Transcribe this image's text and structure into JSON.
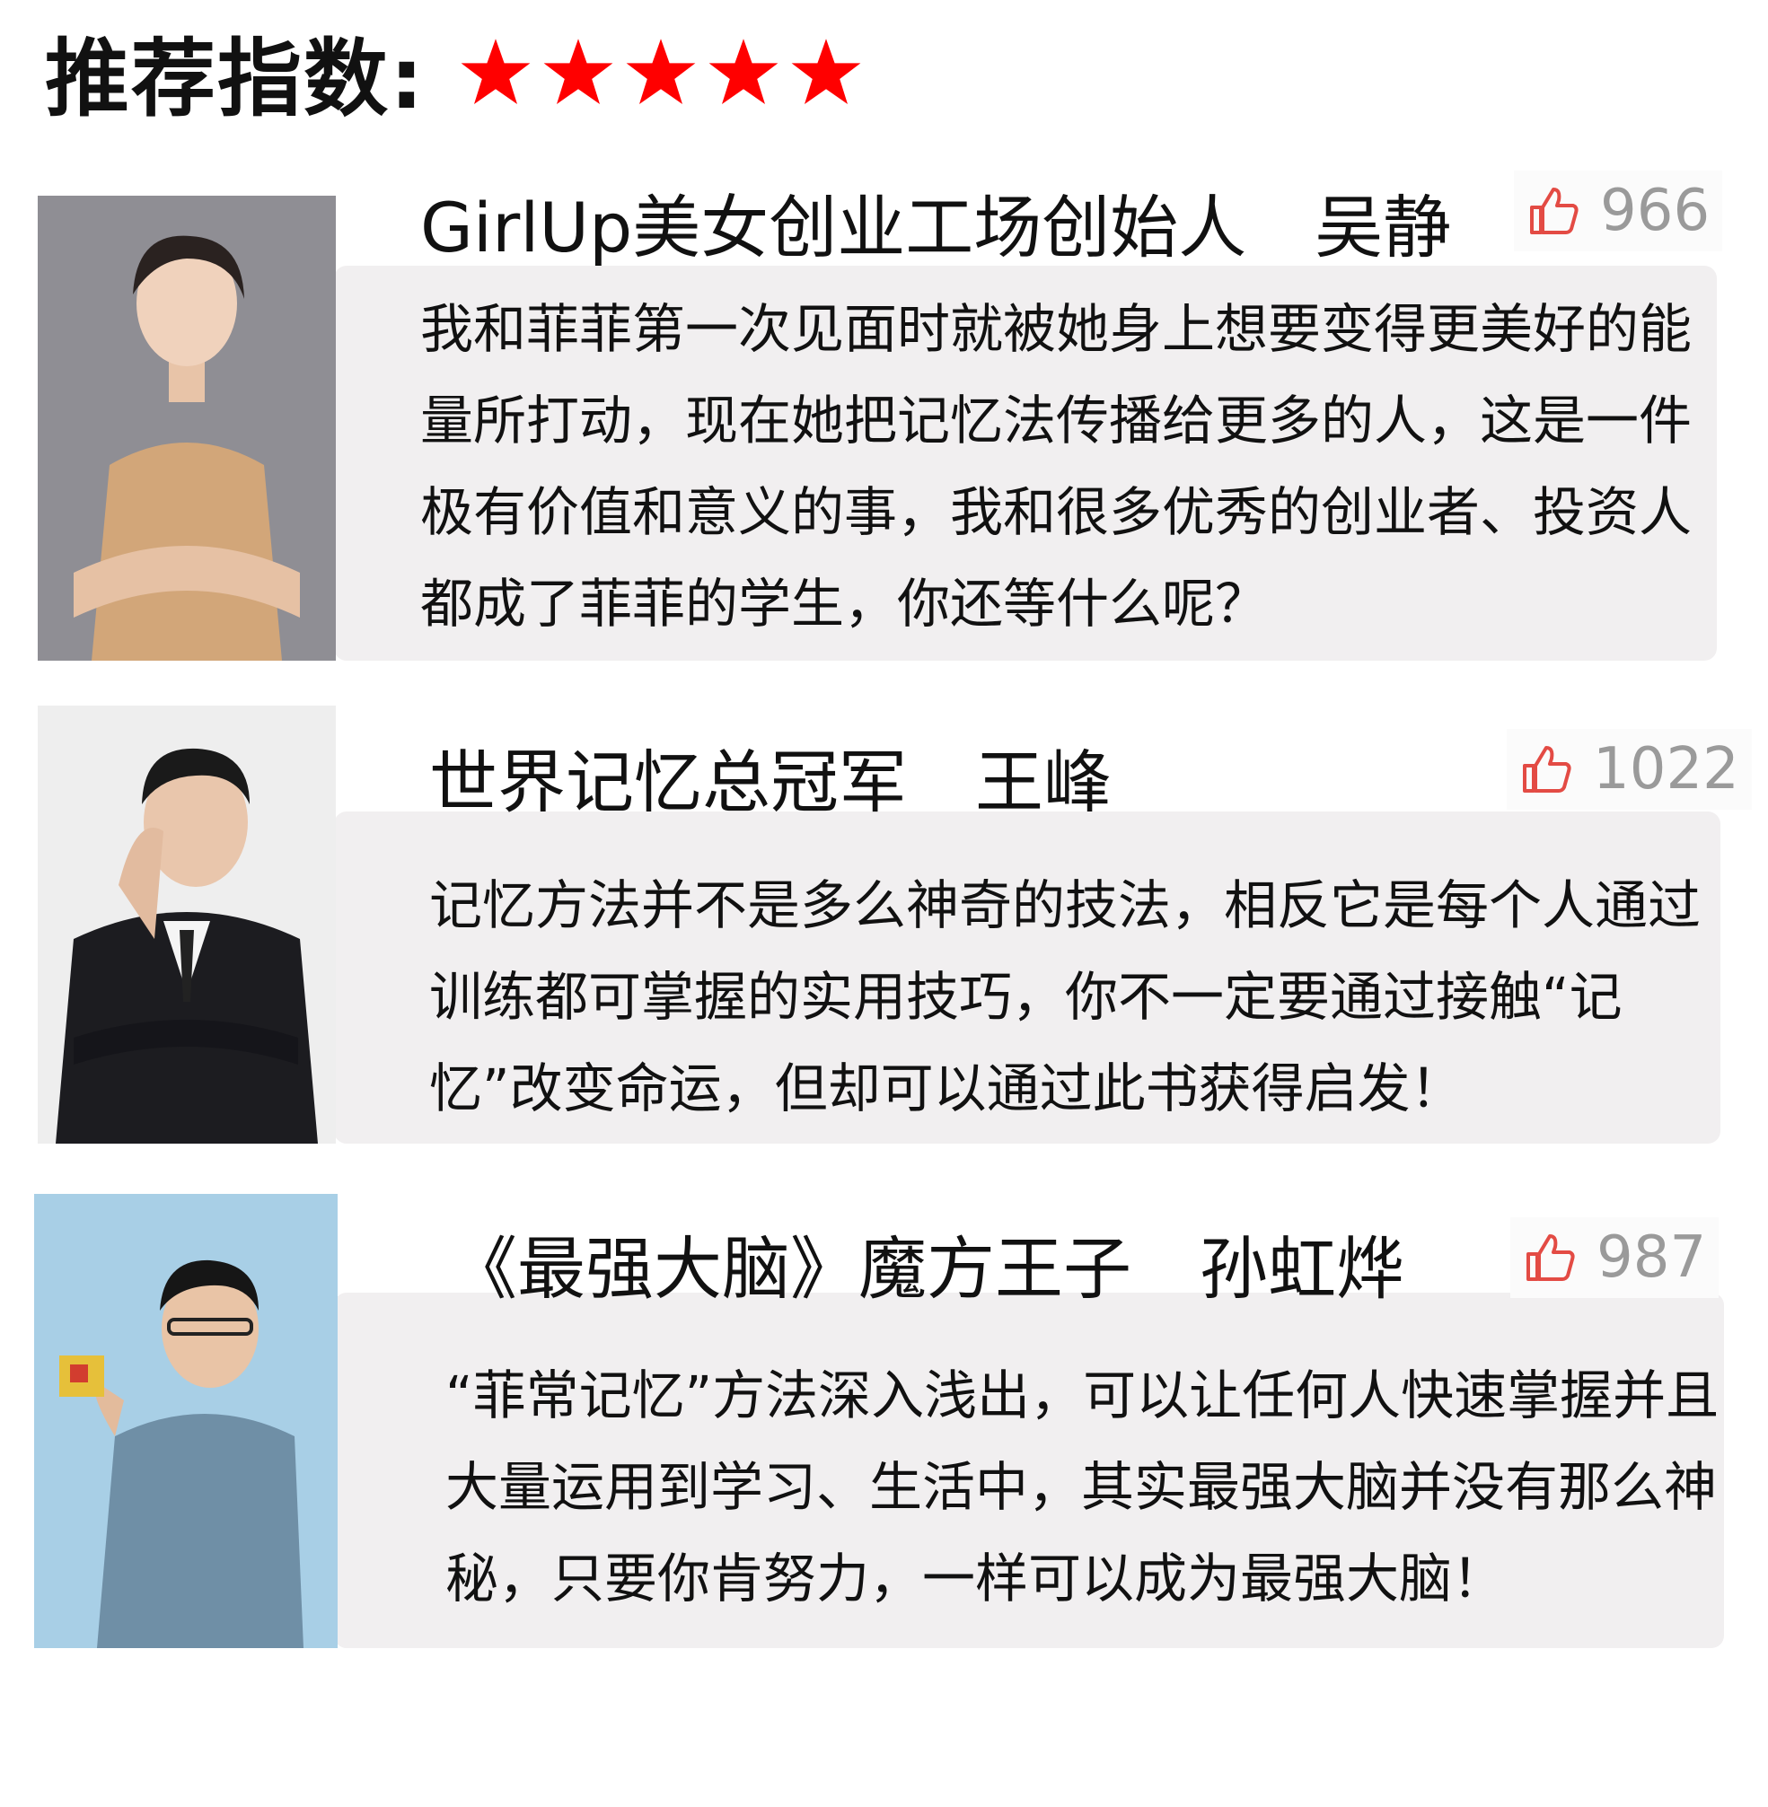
{
  "header": {
    "label": "推荐指数:",
    "rating": 5,
    "max_rating": 5,
    "star_color": "#ff0000"
  },
  "colors": {
    "like_icon": "#e34b44",
    "like_count": "#9a9a9a",
    "bubble_bg": "#f1eff0"
  },
  "recommendations": [
    {
      "title": "GirlUp美女创业工场创始人　吴静",
      "likes": "966",
      "quote": "我和菲菲第一次见面时就被她身上想要变得更美好的能量所打动，现在她把记忆法传播给更多的人，这是一件极有价值和意义的事，我和很多优秀的创业者、投资人都成了菲菲的学生，你还等什么呢？"
    },
    {
      "title": "世界记忆总冠军　王峰",
      "likes": "1022",
      "quote": "记忆方法并不是多么神奇的技法，相反它是每个人通过训练都可掌握的实用技巧，你不一定要通过接触“记忆”改变命运，但却可以通过此书获得启发！"
    },
    {
      "title": "《最强大脑》魔方王子　孙虹烨",
      "likes": "987",
      "quote": "“菲常记忆”方法深入浅出，可以让任何人快速掌握并且大量运用到学习、生活中，其实最强大脑并没有那么神秘，只要你肯努力，一样可以成为最强大脑！"
    }
  ]
}
